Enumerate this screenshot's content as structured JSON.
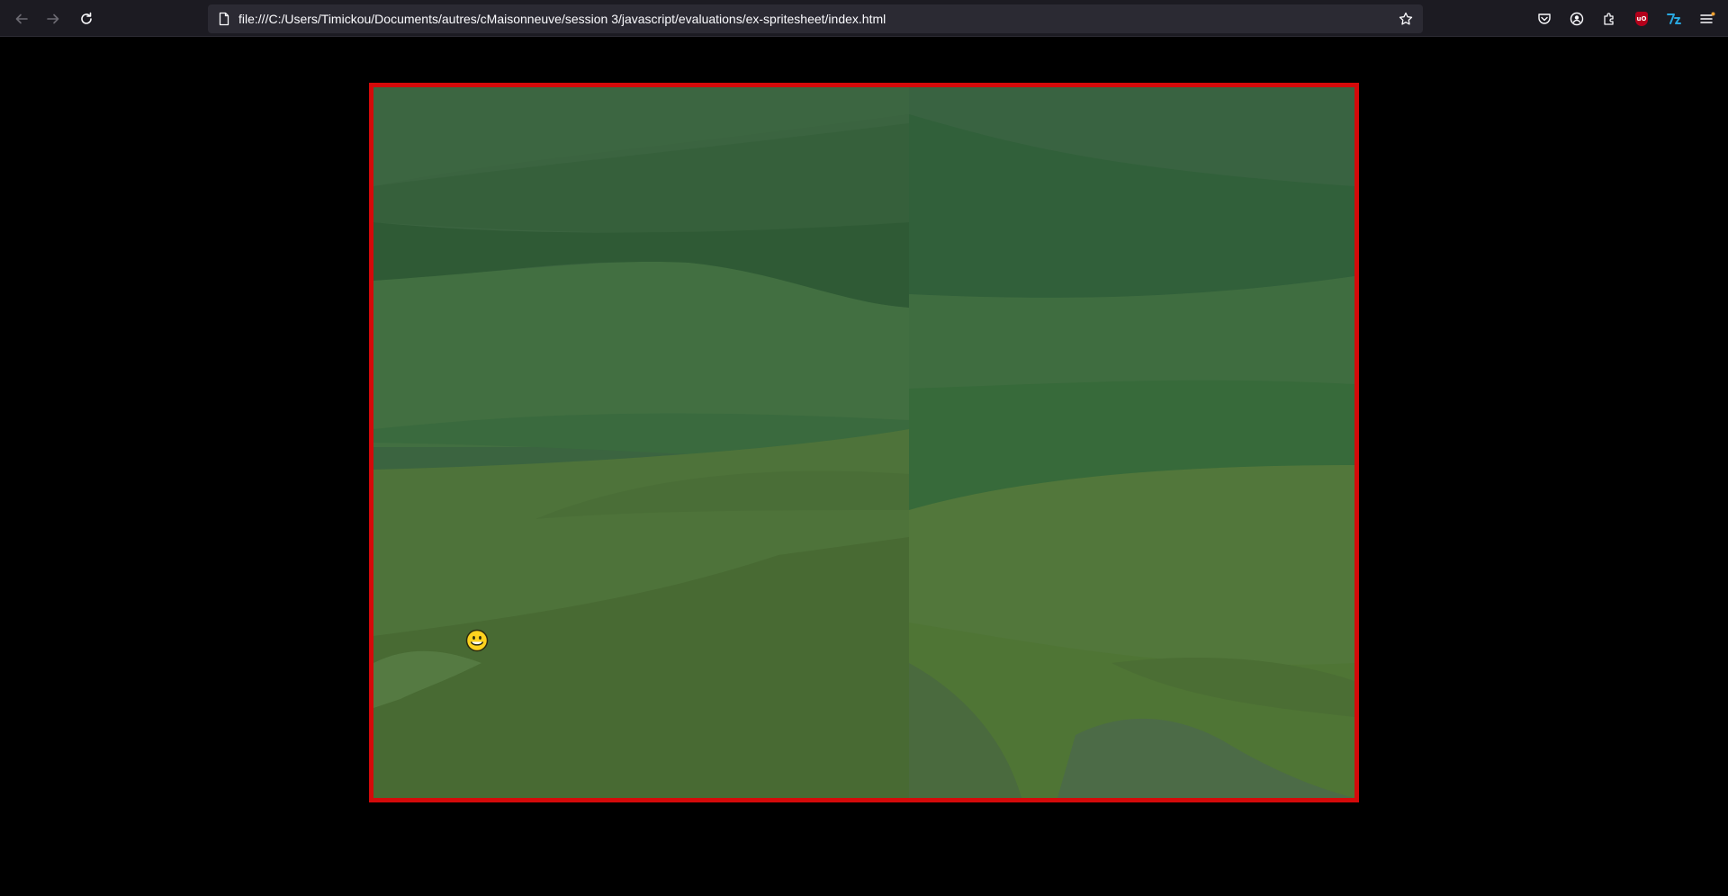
{
  "browser": {
    "url": "file:///C:/Users/Timickou/Documents/autres/cMaisonneuve/session 3/javascript/evaluations/ex-spritesheet/index.html",
    "icons": {
      "back": "back-arrow-icon",
      "forward": "forward-arrow-icon",
      "reload": "reload-icon",
      "page": "page-icon",
      "bookmark": "star-icon",
      "pocket": "pocket-icon",
      "account": "account-icon",
      "extensions": "extensions-icon",
      "ublock": "ublock-origin-icon",
      "translate": "translate-extension-icon",
      "menu": "hamburger-menu-icon"
    },
    "ublock_label": "uO"
  },
  "game": {
    "border_color": "#d40a0a",
    "sprite": "smiley-face-sprite"
  }
}
